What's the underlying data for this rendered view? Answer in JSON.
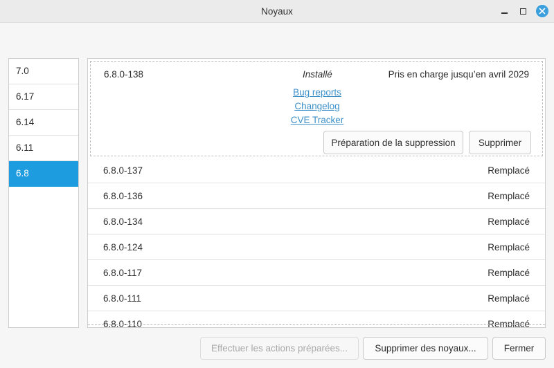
{
  "window": {
    "title": "Noyaux",
    "controls": {
      "minimize_icon": "minimize-icon",
      "maximize_icon": "maximize-icon",
      "close_icon": "close-icon",
      "close_color": "#3a9fdc"
    }
  },
  "sidebar": {
    "selected_index": 4,
    "accent": "#1e9ce0",
    "items": [
      {
        "label": "7.0"
      },
      {
        "label": "6.17"
      },
      {
        "label": "6.14"
      },
      {
        "label": "6.11"
      },
      {
        "label": "6.8"
      }
    ]
  },
  "expanded": {
    "version": "6.8.0-138",
    "status": "Installé",
    "support": "Pris en charge jusqu’en avril 2029",
    "links": [
      "Bug reports",
      "Changelog",
      "CVE Tracker"
    ],
    "prepare_label": "Préparation de la suppression",
    "remove_label": "Supprimer"
  },
  "rows": [
    {
      "version": "6.8.0-137",
      "status": "Remplacé"
    },
    {
      "version": "6.8.0-136",
      "status": "Remplacé"
    },
    {
      "version": "6.8.0-134",
      "status": "Remplacé"
    },
    {
      "version": "6.8.0-124",
      "status": "Remplacé"
    },
    {
      "version": "6.8.0-117",
      "status": "Remplacé"
    },
    {
      "version": "6.8.0-111",
      "status": "Remplacé"
    },
    {
      "version": "6.8.0-110",
      "status": "Remplacé"
    }
  ],
  "footer": {
    "apply_label": "Effectuer les actions préparées...",
    "apply_disabled": true,
    "remove_kernels_label": "Supprimer des noyaux...",
    "close_label": "Fermer"
  }
}
